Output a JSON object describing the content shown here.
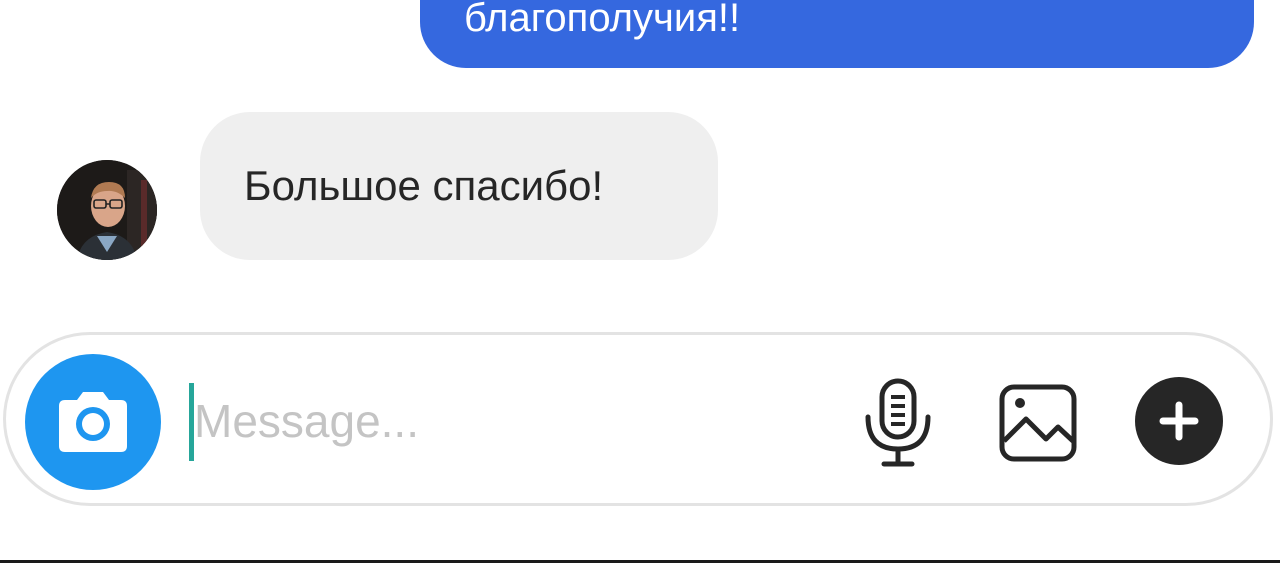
{
  "thread": {
    "outgoing": {
      "text": "благополучия!!"
    },
    "incoming": {
      "text": "Большое спасибо!"
    }
  },
  "composer": {
    "placeholder": "Message...",
    "value": "",
    "icons": {
      "camera": "camera-icon",
      "mic": "microphone-icon",
      "gallery": "image-icon",
      "more": "plus-icon"
    }
  },
  "colors": {
    "outgoing_bubble": "#3568DF",
    "incoming_bubble": "#EFEFEF",
    "camera_button": "#1E96F0",
    "caret": "#26A69A",
    "plus_button": "#262626"
  }
}
